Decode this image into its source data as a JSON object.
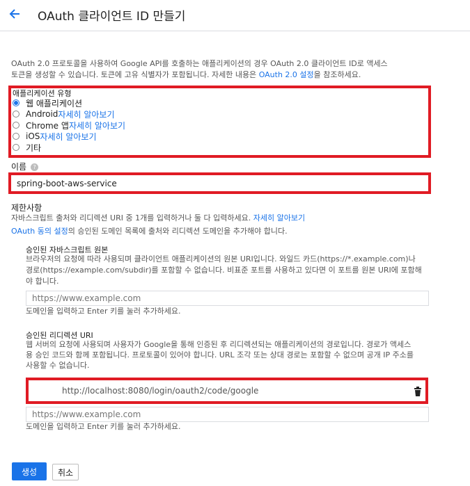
{
  "header": {
    "title": "OAuth 클라이언트 ID 만들기",
    "back_icon": "arrow-left-icon"
  },
  "intro": {
    "line1_a": "OAuth 2.0 프로토콜을 사용하여 Google API를 호출하는 애플리케이션의 경우 OAuth 2.0 클라이언트 ID로 액세스",
    "line2_a": "토큰을 생성할 수 있습니다. 토큰에 고유 식별자가 포함됩니다. 자세한 내용은 ",
    "line2_link": "OAuth 2.0 설정",
    "line2_b": "을 참조하세요."
  },
  "app_type": {
    "label": "애플리케이션 유형",
    "options": [
      {
        "label": "웹 애플리케이션",
        "link": "",
        "selected": true
      },
      {
        "label": "Android ",
        "link": "자세히 알아보기",
        "selected": false
      },
      {
        "label": "Chrome 앱 ",
        "link": "자세히 알아보기",
        "selected": false
      },
      {
        "label": "iOS ",
        "link": "자세히 알아보기",
        "selected": false
      },
      {
        "label": "기타",
        "link": "",
        "selected": false
      }
    ]
  },
  "name": {
    "label": "이름",
    "help_icon": "help-icon",
    "help_glyph": "?",
    "value": "spring-boot-aws-service"
  },
  "restrictions": {
    "title": "제한사항",
    "line1_a": "자바스크립트 출처와 리디렉션 URI 중 1개를 입력하거나 둘 다 입력하세요. ",
    "line1_link": "자세히 알아보기",
    "line2_link": "OAuth 동의 설정",
    "line2_b": "의 승인된 도메인 목록에 출처와 리디렉션 도메인을 추가해야 합니다."
  },
  "origins": {
    "title": "승인된 자바스크립트 원본",
    "desc1": "브라우저의 요청에 따라 사용되며 클라이언트 애플리케이션의 원본 URI입니다. 와일드 카드(https://*.example.com)나",
    "desc2": "경로(https://example.com/subdir)를 포함할 수 없습니다. 비표준 포트를 사용하고 있다면 이 포트를 원본 URI에 포함해",
    "desc3": "야 합니다.",
    "placeholder": "https://www.example.com",
    "hint": "도메인을 입력하고 Enter 키를 눌러 추가하세요."
  },
  "redirects": {
    "title": "승인된 리디렉션 URI",
    "desc1": "웹 서버의 요청에 사용되며 사용자가 Google을 통해 인증된 후 리디렉션되는 애플리케이션의 경로입니다. 경로가 액세스",
    "desc2": "용 승인 코드와 함께 포함됩니다. 프로토콜이 있어야 합니다. URL 조각 또는 상대 경로는 포함할 수 없으며 공개 IP 주소를",
    "desc3": "사용할 수 없습니다.",
    "entry": "http://localhost:8080/login/oauth2/code/google",
    "delete_icon": "trash-icon",
    "placeholder": "https://www.example.com",
    "hint": "도메인을 입력하고 Enter 키를 눌러 추가하세요."
  },
  "actions": {
    "create": "생성",
    "cancel": "취소"
  },
  "colors": {
    "accent": "#1a73e8",
    "highlight": "#e01b24",
    "primary_button": "#1a73e8"
  }
}
